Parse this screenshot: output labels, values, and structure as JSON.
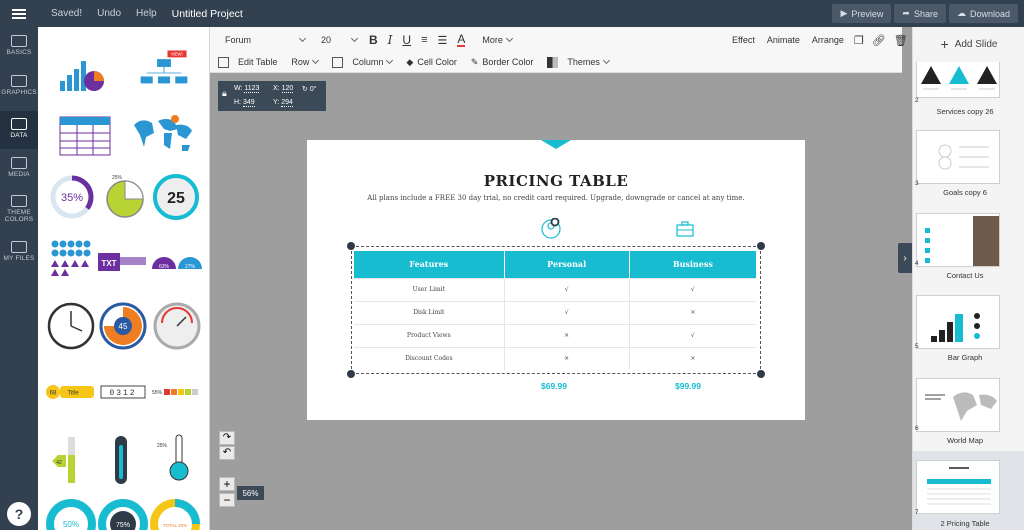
{
  "topbar": {
    "saved": "Saved!",
    "undo": "Undo",
    "help": "Help",
    "project_title": "Untitled Project",
    "preview": "Preview",
    "share": "Share",
    "download": "Download"
  },
  "leftnav": {
    "items": [
      {
        "label": "BASICS"
      },
      {
        "label": "GRAPHICS"
      },
      {
        "label": "DATA"
      },
      {
        "label": "MEDIA"
      },
      {
        "label": "THEME COLORS"
      },
      {
        "label": "MY FILES"
      }
    ],
    "help": "?"
  },
  "panel": {
    "badge_new": "NEW!",
    "gauge_35": "35%",
    "gauge_25": "25%",
    "counter_25": "25",
    "txt_label": "TXT",
    "pct_63": "63%",
    "pct_27": "27%",
    "clock_45": "45",
    "tag_68": "68",
    "tag_title": "Title",
    "odometer": "0312",
    "bar_55": "55%",
    "therm_42": "42",
    "therm_25": "25%",
    "donut_50": "50%",
    "donut_75": "75%",
    "donut_total": "TOTAL 25%"
  },
  "toolbar": {
    "font": "Forum",
    "size": "20",
    "more": "More",
    "effect": "Effect",
    "animate": "Animate",
    "arrange": "Arrange",
    "edit_table": "Edit Table",
    "row": "Row",
    "column": "Column",
    "cell_color": "Cell Color",
    "border_color": "Border Color",
    "themes": "Themes"
  },
  "dims": {
    "w_label": "W:",
    "w": "1123",
    "x_label": "X:",
    "x": "120",
    "rot": "0°",
    "h_label": "H:",
    "h": "349",
    "y_label": "Y:",
    "y": "294"
  },
  "slide": {
    "title": "PRICING TABLE",
    "subtitle": "All plans include a FREE 30 day trial, no credit card required. Upgrade, downgrade or cancel at any time.",
    "headers": [
      "Features",
      "Personal",
      "Business"
    ],
    "rows": [
      {
        "feature": "User Limit",
        "personal": "√",
        "business": "√"
      },
      {
        "feature": "Disk Limit",
        "personal": "√",
        "business": "×"
      },
      {
        "feature": "Product Views",
        "personal": "×",
        "business": "√"
      },
      {
        "feature": "Discount Codes",
        "personal": "×",
        "business": "×"
      }
    ],
    "price_personal": "$69.99",
    "price_business": "$99.99"
  },
  "zoom": "56%",
  "rightpanel": {
    "add_slide": "Add Slide",
    "slides": [
      {
        "num": "2",
        "name": "Services copy 26"
      },
      {
        "num": "3",
        "name": "Goals copy 6"
      },
      {
        "num": "4",
        "name": "Contact Us"
      },
      {
        "num": "5",
        "name": "Bar Graph"
      },
      {
        "num": "6",
        "name": "World Map"
      },
      {
        "num": "7",
        "name": "2 Pricing Table"
      }
    ]
  },
  "colors": {
    "accent": "#18bcd0",
    "nav": "#33404f",
    "purple": "#6b2fa0",
    "orange": "#ef7d22"
  }
}
